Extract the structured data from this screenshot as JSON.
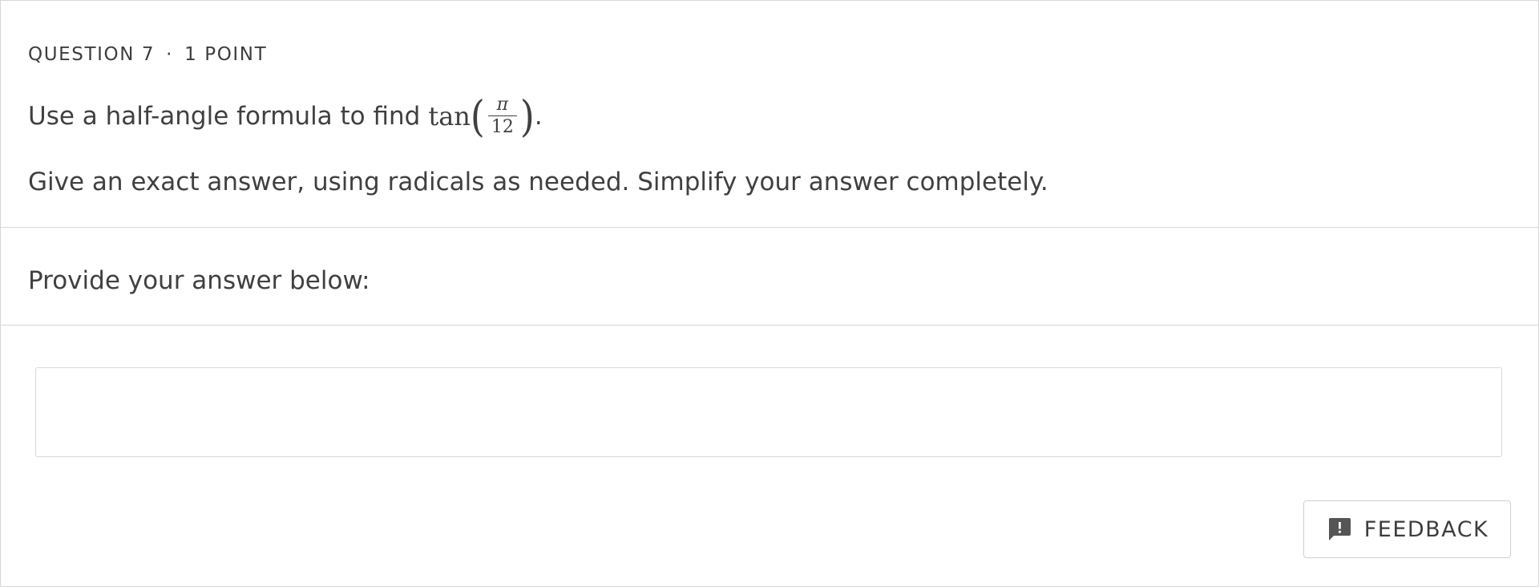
{
  "question": {
    "number_label": "QUESTION 7",
    "separator": "·",
    "points_label": "1 POINT",
    "prompt_text": "Use a half-angle formula to find",
    "math": {
      "function": "tan",
      "open_paren": "(",
      "numerator": "π",
      "denominator": "12",
      "close_paren": ")"
    },
    "prompt_end": ".",
    "instruction": "Give an exact answer, using radicals as needed. Simplify your answer completely."
  },
  "answer": {
    "label": "Provide your answer below:",
    "value": "",
    "placeholder": ""
  },
  "feedback": {
    "label": "FEEDBACK",
    "icon": "feedback-icon"
  },
  "colors": {
    "text": "#404040",
    "border": "#d6d6d6",
    "icon": "#555555"
  }
}
